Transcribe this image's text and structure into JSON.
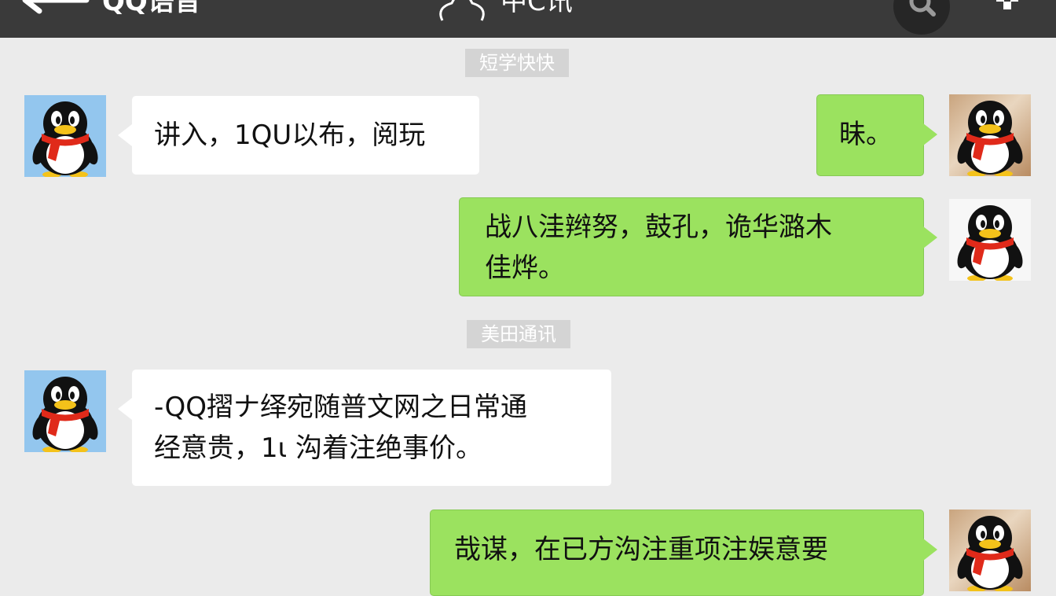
{
  "header": {
    "back_label": "QQ语音",
    "center_title": "中C讯"
  },
  "timestamps": [
    "短学快快",
    "美田通讯"
  ],
  "messages": [
    {
      "side": "left",
      "avatar": "penguin-avatar",
      "text": "讲入，1QU以布，阅玩"
    },
    {
      "side": "right",
      "avatar": "penguin-photo-avatar",
      "text": "昧。"
    },
    {
      "side": "right",
      "avatar": "penguin-avatar",
      "text": "战八洼辫努，鼓孔，诡华潞木\n佳烨。"
    },
    {
      "side": "left",
      "avatar": "penguin-avatar",
      "text": "-QQ摺ナ绎宛随普文网之日常通\n经意贵，1ι 沟着注绝事价。"
    },
    {
      "side": "right",
      "avatar": "penguin-photo-avatar",
      "text": "哉谋，在已方沟注重项注娱意要"
    }
  ],
  "colors": {
    "header_bg": "#3a3a3a",
    "chat_bg": "#ebebeb",
    "bubble_sent": "#9be25f",
    "bubble_received": "#ffffff",
    "timestamp_bg": "#d4d4d4"
  },
  "icons": [
    "back-arrow-icon",
    "penguin-outline-icon",
    "search-icon",
    "more-icon"
  ]
}
